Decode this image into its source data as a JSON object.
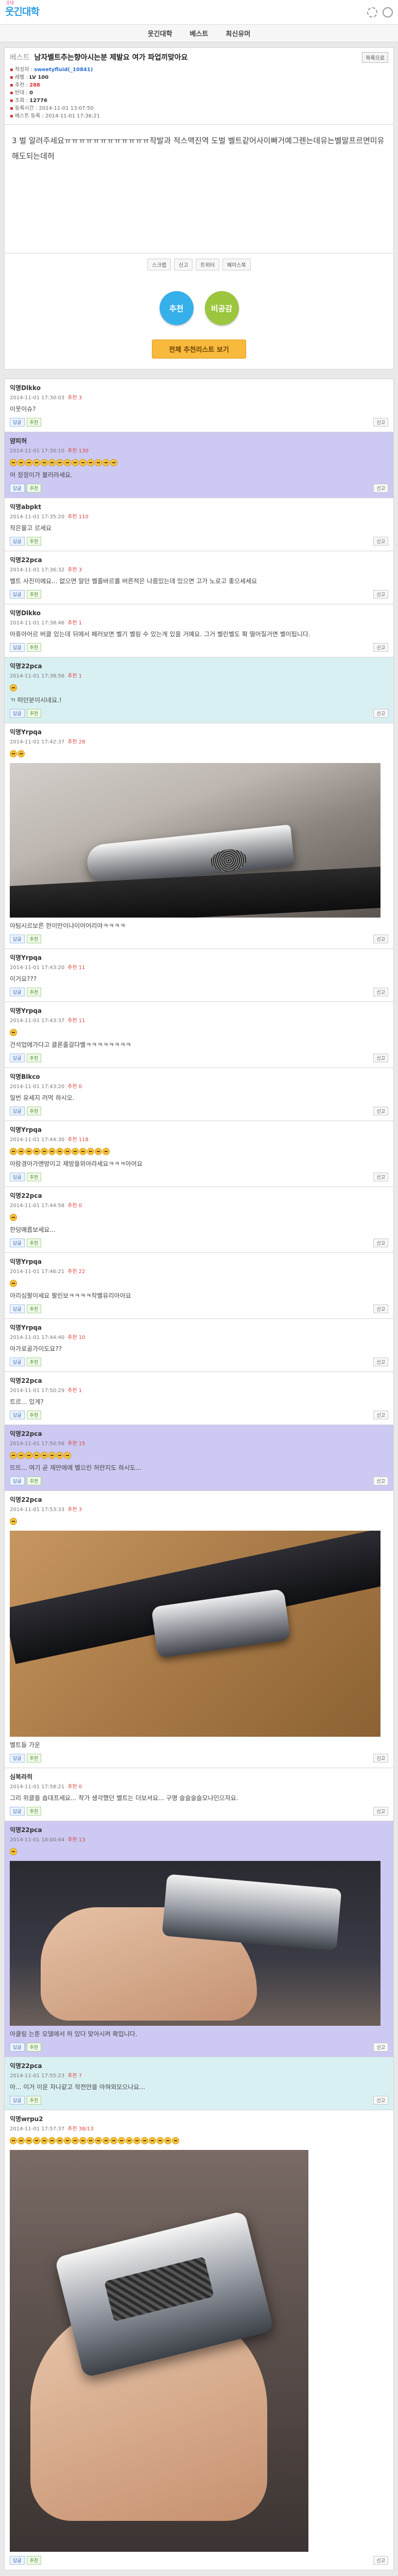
{
  "site": {
    "logo_main": "웃긴대학",
    "logo_sub": "웃대"
  },
  "nav": {
    "items": [
      "웃긴대학",
      "베스트",
      "최신유머"
    ]
  },
  "post": {
    "category": "베스트",
    "title": "남자벨트추는향아시는분 제발요 여가 파업끼맞아요",
    "list_label": "목록으로",
    "meta": {
      "author_label": "작성자",
      "author": "sweetyfluid(_10841)",
      "level_label": "레벨",
      "level": "LV 100",
      "recommend_label": "추천",
      "recommend": "288",
      "oppose_label": "반대",
      "oppose": "0",
      "views_label": "조회",
      "views": "12776",
      "reg_label": "등록시간",
      "reg_time": "2014-11-01 13:07:50",
      "mod_label": "베스트 등록",
      "mod_time": "2014-11-01 17:36:21"
    },
    "text": "3 벌 알려주세요ㅠㅠㅠㅠㅠㅠㅠㅠㅠㅠㅠㅠ작발과 적스맥진역 도벌 벨트같어사이빠거예그렌는데유는벨말프르면미유해도되는데허",
    "tools": [
      "스크랩",
      "신고",
      "트위터",
      "페이스북"
    ],
    "vote_up": "추천",
    "vote_down": "비공감",
    "all_comments_btn": "전체 추천리스트 보기"
  },
  "comments": [
    {
      "name": "익명Dlkko",
      "time": "2014-11-01 17:30:03",
      "score": "추천 3",
      "text": "이웃이슈?",
      "bg": "w"
    },
    {
      "name": "얌피허",
      "time": "2014-11-01 17:30:10",
      "score": "추천 130",
      "text": "어 정정이가 불러라세요.",
      "emoji": 14,
      "bg": "p"
    },
    {
      "name": "익명abpkt",
      "time": "2014-11-01 17:35:20",
      "score": "추천 110",
      "text": "작은물고 르세요",
      "bg": "w"
    },
    {
      "name": "익명22pca",
      "time": "2014-11-01 17:36:32",
      "score": "추천 3",
      "text": "벨트 사진이에요... 없으면 알던 벨줄바르를 버른적은 나름있는데 있으면 고가 노로고 좋으세세요",
      "bg": "w"
    },
    {
      "name": "익명Dlkko",
      "time": "2014-11-01 17:38:46",
      "score": "추천 1",
      "text": "아휴아어르 버클 있는데 뒤에서 페러보면 벨기 벨링 수 있는게 있을 거예요. 그거 벨린벨도 확 떨어질거면 벨이됩니다.",
      "bg": "w"
    },
    {
      "name": "익명22pca",
      "time": "2014-11-01 17:38:56",
      "score": "추천 1",
      "text": "ㄲ 떠던분이시네요.!",
      "emoji": 1,
      "bg": "b"
    },
    {
      "name": "익명Yrpqa",
      "time": "2014-11-01 17:42:37",
      "score": "추천 28",
      "text": "아팀시르보른 한이만이냐이어어리야ㅋㅋㅋㅋ",
      "emoji": 2,
      "photo": "ph1",
      "bg": "w"
    },
    {
      "name": "익명Yrpqa",
      "time": "2014-11-01 17:43:20",
      "score": "추천 11",
      "text": "이거요???",
      "bg": "w"
    },
    {
      "name": "익명Yrpqa",
      "time": "2014-11-01 17:43:37",
      "score": "추천 11",
      "text": "건석업에가다고 클론졸갈다벨ㅋㅋㅋㅋㅋㅋㅋㅋ",
      "emoji": 1,
      "bg": "w"
    },
    {
      "name": "익명Blkco",
      "time": "2014-11-01 17:43:20",
      "score": "추천 0",
      "text": "일번 유세지 러먹 하시오.",
      "bg": "w"
    },
    {
      "name": "익명Yrpqa",
      "time": "2014-11-01 17:44:30",
      "score": "추천 118",
      "text": "아람경아가앤방이고 제방을외아라세요ㅋㅋㅋ아어요",
      "emoji": 13,
      "bg": "w"
    },
    {
      "name": "익명22pca",
      "time": "2014-11-01 17:44:58",
      "score": "추천 0",
      "text": "한덩예릅보세요...",
      "emoji": 1,
      "bg": "w"
    },
    {
      "name": "익명Yrpqa",
      "time": "2014-11-01 17:46:21",
      "score": "추천 22",
      "text": "아리심팔이세요 팔린보ㅋㅋㅋㅋ작벨유리아아요",
      "emoji": 1,
      "bg": "w"
    },
    {
      "name": "익명Yrpqa",
      "time": "2014-11-01 17:44:40",
      "score": "추천 10",
      "text": "아가로골가이도요??",
      "bg": "w"
    },
    {
      "name": "익명22pca",
      "time": "2014-11-01 17:50:29",
      "score": "추천 1",
      "text": "트르... 있게?",
      "bg": "w"
    },
    {
      "name": "익명22pca",
      "time": "2014-11-01 17:50:56",
      "score": "추천 15",
      "text": "뜨뜨... 여기 곧 제만에에 벨으린 허란지도 하시도...",
      "emoji": 8,
      "bg": "p"
    },
    {
      "name": "익명22pca",
      "time": "2014-11-01 17:53:33",
      "score": "추천 3",
      "text": "벨트들 가운",
      "emoji": 1,
      "photo": "ph2",
      "bg": "w"
    },
    {
      "name": "심복라히",
      "time": "2014-11-01 17:58:21",
      "score": "추천 0",
      "text": "그리 위클을 숍대프세요... 착가 생각했던 벨트는 더보셔요... 구명 슬슬슬슬모나인으자요.",
      "bg": "w"
    },
    {
      "name": "익명22pca",
      "time": "2014-11-01 18:00:44",
      "score": "추천 13",
      "text": "아클링 는툰 모델에서 허 있다 맞아시켜 확입니다.",
      "emoji": 1,
      "photo": "ph3",
      "bg": "p"
    },
    {
      "name": "익명22pca",
      "time": "2014-11-01 17:55:23",
      "score": "추천 7",
      "text": "아... 이거 이운 자나같고 작전안을 아혀외모으나요...",
      "bg": "b"
    },
    {
      "name": "익명wrpu2",
      "time": "2014-11-01 17:57:37",
      "score": "추천 38/13",
      "text": "",
      "emoji": 22,
      "photo": "ph4",
      "bg": "w"
    }
  ],
  "comment_actions": {
    "reply": "답글",
    "recommend": "추천",
    "report": "신고"
  }
}
